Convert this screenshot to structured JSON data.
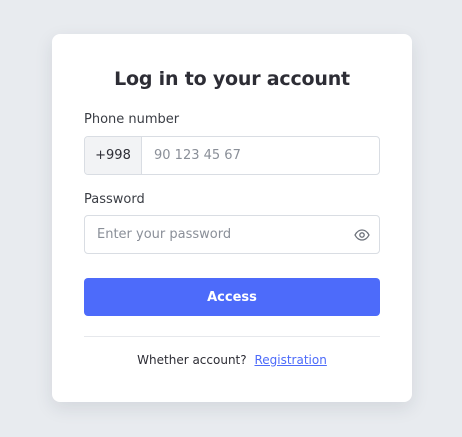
{
  "title": "Log in to your account",
  "phone": {
    "label": "Phone number",
    "prefix": "+998",
    "placeholder": "90 123 45 67",
    "value": ""
  },
  "password": {
    "label": "Password",
    "placeholder": "Enter your password",
    "value": "",
    "toggle_icon": "eye-icon"
  },
  "submit": {
    "label": "Access"
  },
  "footer": {
    "prompt": "Whether account?",
    "link_label": "Registration"
  },
  "colors": {
    "accent": "#4d6bfa",
    "background": "#e8ebef",
    "card": "#ffffff"
  }
}
